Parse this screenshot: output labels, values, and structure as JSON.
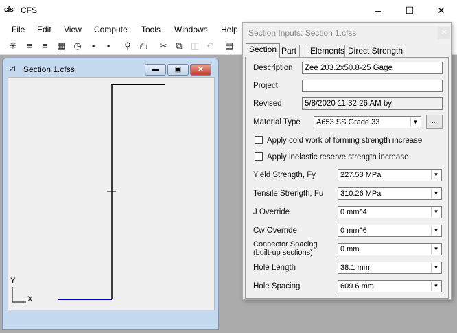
{
  "app": {
    "title": "CFS",
    "logo": "CFS"
  },
  "menu": [
    "File",
    "Edit",
    "View",
    "Compute",
    "Tools",
    "Windows",
    "Help"
  ],
  "child": {
    "title": "Section 1.cfss",
    "axis_y": "Y",
    "axis_x": "X"
  },
  "dialog": {
    "title": "Section Inputs: Section 1.cfss",
    "tabs": [
      "Section",
      "Part",
      "Elements",
      "Direct Strength"
    ],
    "active_tab": "Section",
    "description_label": "Description",
    "description": "Zee 203.2x50.8-25 Gage",
    "project_label": "Project",
    "project": "",
    "revised_label": "Revised",
    "revised": "5/8/2020 11:32:26 AM by",
    "material_label": "Material Type",
    "material": "A653 SS Grade 33",
    "material_btn": "...",
    "cold_work": "Apply cold work of forming strength increase",
    "inelastic": "Apply inelastic reserve strength increase",
    "props": [
      {
        "label": "Yield Strength, Fy",
        "value": "227.53 MPa"
      },
      {
        "label": "Tensile Strength, Fu",
        "value": "310.26 MPa"
      },
      {
        "label": "J Override",
        "value": "0 mm^4"
      },
      {
        "label": "Cw Override",
        "value": "0 mm^6"
      },
      {
        "label": "Connector Spacing\n(built-up sections)",
        "value": "0 mm"
      },
      {
        "label": "Hole Length",
        "value": "38.1 mm"
      },
      {
        "label": "Hole Spacing",
        "value": "609.6 mm"
      }
    ]
  }
}
